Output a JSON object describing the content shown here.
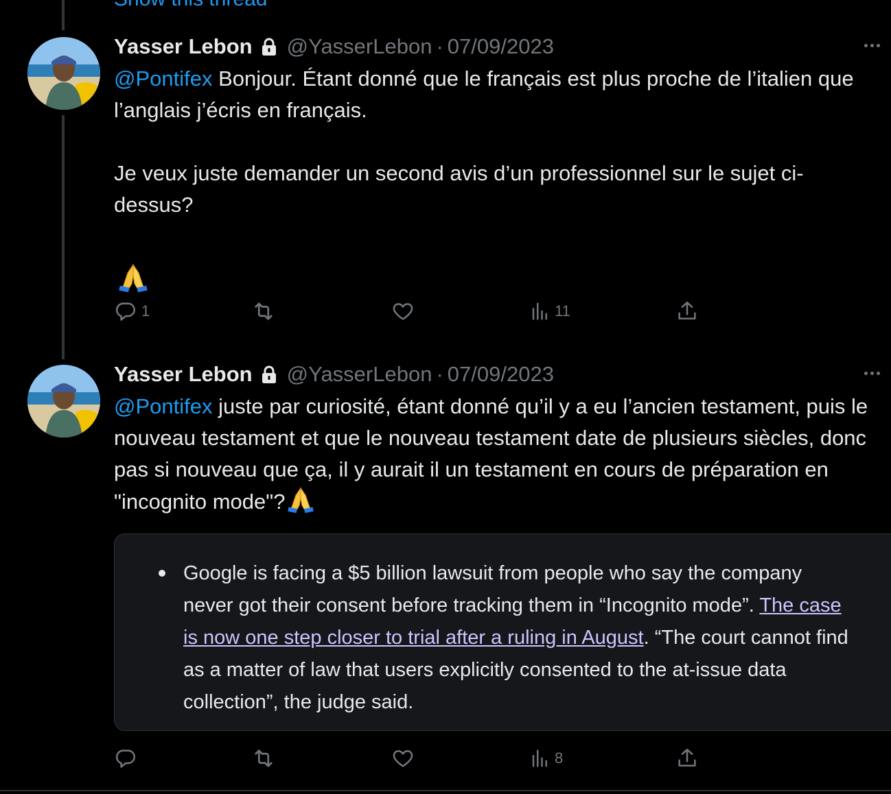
{
  "thread": {
    "show_thread_label": "Show this thread"
  },
  "tweets": [
    {
      "author_name": "Yasser Lebon",
      "handle": "@YasserLebon",
      "separator": "·",
      "date": "07/09/2023",
      "mention": "@Pontifex",
      "text_line1": " Bonjour. Étant donné que le français est plus proche de l’italien que l’anglais j’écris en français.",
      "text_para2": "Je veux juste demander un second avis d’un professionnel sur le sujet ci-dessus?",
      "emoji": "folded-hands",
      "stats": {
        "replies": "1",
        "retweets": "",
        "likes": "",
        "views": "11"
      }
    },
    {
      "author_name": "Yasser Lebon",
      "handle": "@YasserLebon",
      "separator": "·",
      "date": "07/09/2023",
      "mention": "@Pontifex",
      "text_line1": " juste par curiosité, étant donné qu’il y a eu l’ancien testament, puis le nouveau testament et que le nouveau testament date de plusieurs siècles, donc pas si nouveau que ça, il y aurait il un testament en cours de préparation en \"incognito mode\"?",
      "emoji": "folded-hands",
      "quote": {
        "text_before": "Google is facing a $5 billion lawsuit from people who say the company never got their consent before tracking them in “Incognito mode”. ",
        "link_text": "The case is now one step closer to trial after a ruling in August",
        "text_after": ". “The court cannot find as a matter of law that users explicitly consented to the at-issue data collection”, the judge said."
      },
      "stats": {
        "replies": "",
        "retweets": "",
        "likes": "",
        "views": "8"
      }
    }
  ],
  "colors": {
    "background": "#000000",
    "text": "#e7e9ea",
    "secondary": "#71767b",
    "accent": "#1d9bf0",
    "link": "#c9c6ff"
  }
}
